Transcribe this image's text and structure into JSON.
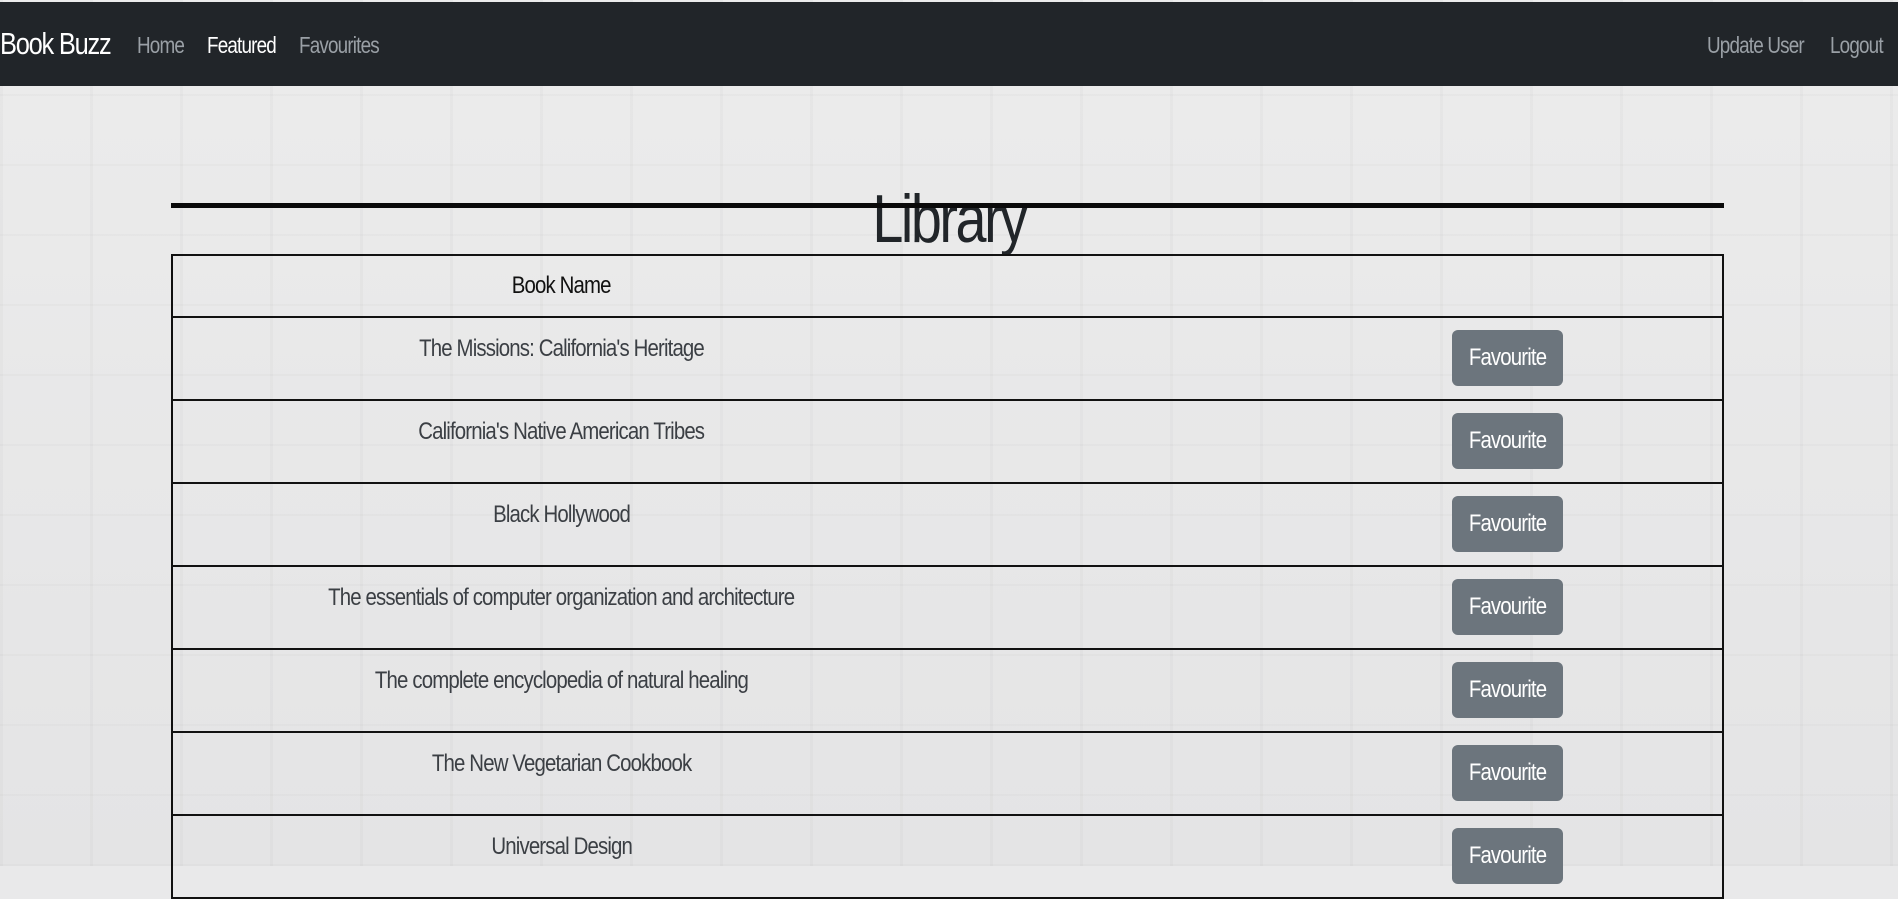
{
  "navbar": {
    "brand": "Book Buzz",
    "links": [
      {
        "label": "Home"
      },
      {
        "label": "Featured"
      },
      {
        "label": "Favourites"
      }
    ],
    "right_links": [
      {
        "label": "Update User"
      },
      {
        "label": "Logout"
      }
    ]
  },
  "page": {
    "title": "Library"
  },
  "table": {
    "columns": [
      "Book Name",
      ""
    ],
    "button_label": "Favourite",
    "rows": [
      {
        "name": "The Missions: California's Heritage"
      },
      {
        "name": "California's Native American Tribes"
      },
      {
        "name": "Black Hollywood"
      },
      {
        "name": "The essentials of computer organization and architecture"
      },
      {
        "name": "The complete encyclopedia of natural healing"
      },
      {
        "name": "The New Vegetarian Cookbook"
      },
      {
        "name": "Universal Design"
      }
    ]
  },
  "colors": {
    "navbar_bg": "#212529",
    "button_bg": "#6c757d",
    "active_link": "#ffffff",
    "inactive_link": "#9aa0a6"
  }
}
